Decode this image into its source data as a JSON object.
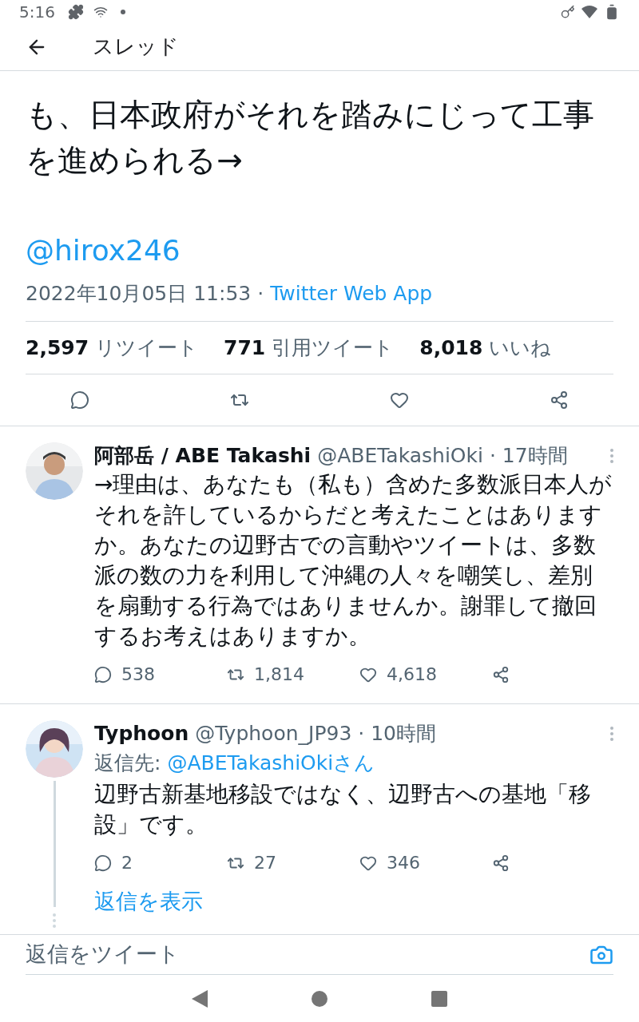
{
  "status_bar": {
    "time": "5:16"
  },
  "header": {
    "title": "スレッド"
  },
  "tweet": {
    "text": "も、日本政府がそれを踏みにじって工事を進められる→",
    "handle": "@hirox246",
    "date": "2022年10月05日 11:53",
    "separator": "·",
    "source": "Twitter Web App",
    "stats": [
      {
        "count": "2,597",
        "label": "リツイート"
      },
      {
        "count": "771",
        "label": "引用ツイート"
      },
      {
        "count": "8,018",
        "label": "いいね"
      }
    ]
  },
  "replies": [
    {
      "name": "阿部岳 / ABE Takashi",
      "handle": "@ABETakashiOki",
      "separator": "·",
      "time": "17時間",
      "text": "→理由は、あなたも（私も）含めた多数派日本人がそれを許しているからだと考えたことはありますか。あなたの辺野古での言動やツイートは、多数派の数の力を利用して沖縄の人々を嘲笑し、差別を扇動する行為ではありませんか。謝罪して撤回するお考えはありますか。",
      "replies": "538",
      "retweets": "1,814",
      "likes": "4,618",
      "thread": false
    },
    {
      "name": "Typhoon",
      "handle": "@Typhoon_JP93",
      "separator": "·",
      "time": "10時間",
      "reply_to": {
        "label": "返信先:",
        "target": "@ABETakashiOkiさん"
      },
      "text": "辺野古新基地移設ではなく、辺野古への基地「移設」です。",
      "replies": "2",
      "retweets": "27",
      "likes": "346",
      "thread": true,
      "show_replies": "返信を表示"
    }
  ],
  "compose": {
    "placeholder": "返信をツイート"
  }
}
